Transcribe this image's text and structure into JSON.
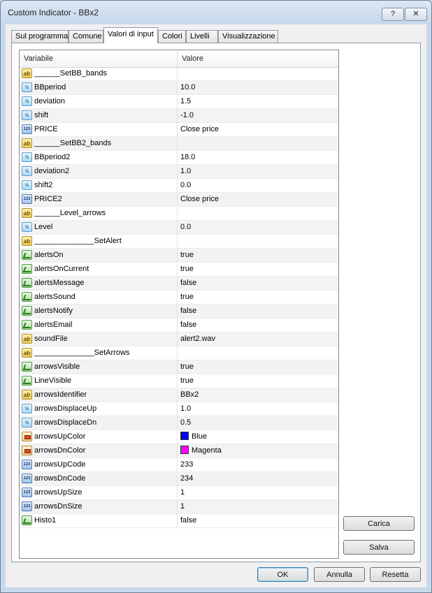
{
  "window": {
    "title": "Custom Indicator - BBx2",
    "help_label": "?",
    "close_label": "✕"
  },
  "tabs": [
    {
      "label": "Sul programma",
      "active": false
    },
    {
      "label": "Comune",
      "active": false
    },
    {
      "label": "Valori di input",
      "active": true
    },
    {
      "label": "Colori",
      "active": false
    },
    {
      "label": "Livelli",
      "active": false
    },
    {
      "label": "Visualizzazione",
      "active": false
    }
  ],
  "grid": {
    "headers": {
      "variable": "Variabile",
      "value": "Valore"
    },
    "rows": [
      {
        "type": "string",
        "name": "______SetBB_bands",
        "value": ""
      },
      {
        "type": "double",
        "name": "BBperiod",
        "value": "10.0"
      },
      {
        "type": "double",
        "name": "deviation",
        "value": "1.5"
      },
      {
        "type": "double",
        "name": "shift",
        "value": "-1.0"
      },
      {
        "type": "int",
        "name": "PRICE",
        "value": "Close price"
      },
      {
        "type": "string",
        "name": "______SetBB2_bands",
        "value": ""
      },
      {
        "type": "double",
        "name": "BBperiod2",
        "value": "18.0"
      },
      {
        "type": "double",
        "name": "deviation2",
        "value": "1.0"
      },
      {
        "type": "double",
        "name": "shift2",
        "value": "0.0"
      },
      {
        "type": "int",
        "name": "PRICE2",
        "value": "Close price"
      },
      {
        "type": "string",
        "name": "______Level_arrows",
        "value": ""
      },
      {
        "type": "double",
        "name": "Level",
        "value": "0.0"
      },
      {
        "type": "string",
        "name": "______________SetAlert",
        "value": ""
      },
      {
        "type": "bool",
        "name": "alertsOn",
        "value": "true"
      },
      {
        "type": "bool",
        "name": "alertsOnCurrent",
        "value": "true"
      },
      {
        "type": "bool",
        "name": "alertsMessage",
        "value": "false"
      },
      {
        "type": "bool",
        "name": "alertsSound",
        "value": "true"
      },
      {
        "type": "bool",
        "name": "alertsNotify",
        "value": "false"
      },
      {
        "type": "bool",
        "name": "alertsEmail",
        "value": "false"
      },
      {
        "type": "string",
        "name": "soundFile",
        "value": "alert2.wav"
      },
      {
        "type": "string",
        "name": "______________SetArrows",
        "value": ""
      },
      {
        "type": "bool",
        "name": "arrowsVisible",
        "value": "true"
      },
      {
        "type": "bool",
        "name": "LineVisible",
        "value": "true"
      },
      {
        "type": "string",
        "name": "arrowsIdentifier",
        "value": "BBx2"
      },
      {
        "type": "double",
        "name": "arrowsDisplaceUp",
        "value": "1.0"
      },
      {
        "type": "double",
        "name": "arrowsDisplaceDn",
        "value": "0.5"
      },
      {
        "type": "color",
        "name": "arrowsUpColor",
        "value": "Blue",
        "swatch": "#0000ff"
      },
      {
        "type": "color",
        "name": "arrowsDnColor",
        "value": "Magenta",
        "swatch": "#ff00ff"
      },
      {
        "type": "int",
        "name": "arrowsUpCode",
        "value": "233"
      },
      {
        "type": "int",
        "name": "arrowsDnCode",
        "value": "234"
      },
      {
        "type": "int",
        "name": "arrowsUpSize",
        "value": "1"
      },
      {
        "type": "int",
        "name": "arrowsDnSize",
        "value": "1"
      },
      {
        "type": "bool",
        "name": "Histo1",
        "value": "false"
      }
    ]
  },
  "icons": {
    "string": "ab",
    "double": "½",
    "int": "123"
  },
  "buttons": {
    "load": "Carica",
    "save": "Salva",
    "ok": "OK",
    "cancel": "Annulla",
    "reset": "Resetta"
  }
}
